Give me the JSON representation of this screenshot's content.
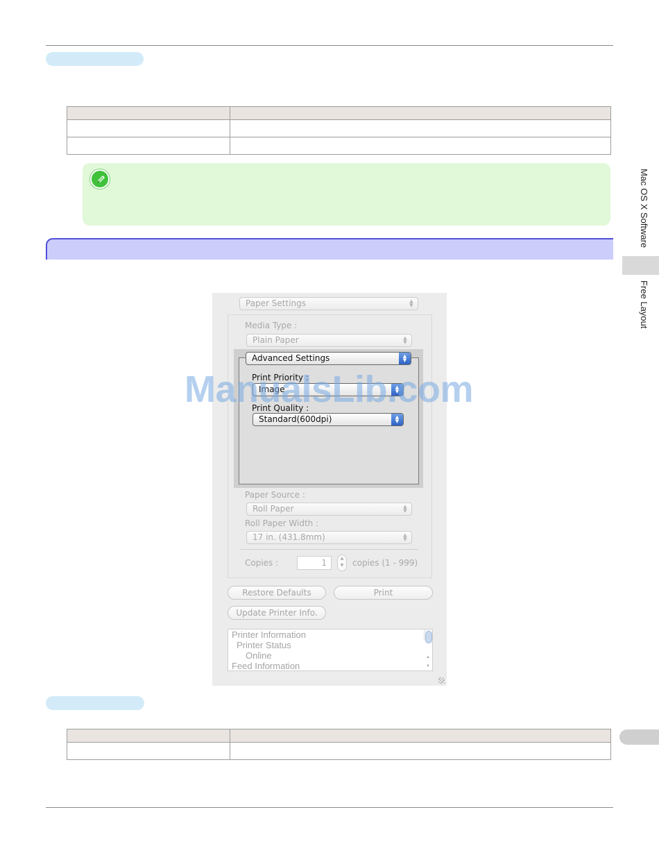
{
  "side_index": {
    "chapter": "Mac OS X Software",
    "section": "Free Layout"
  },
  "dialog": {
    "paper_settings_popup": "Paper Settings",
    "media_type_label": "Media Type :",
    "media_type_value": "Plain Paper",
    "advanced_settings_popup": "Advanced Settings",
    "print_priority_label": "Print Priority :",
    "print_priority_value": "Image",
    "print_quality_label": "Print Quality :",
    "print_quality_value": "Standard(600dpi)",
    "paper_source_label": "Paper Source :",
    "paper_source_value": "Roll Paper",
    "roll_paper_width_label": "Roll Paper Width :",
    "roll_paper_width_value": "17 in. (431.8mm)",
    "copies_label": "Copies :",
    "copies_value": "1",
    "copies_range": "copies (1 - 999)",
    "restore_defaults_button": "Restore Defaults",
    "print_button": "Print",
    "update_printer_info_button": "Update Printer Info.",
    "printer_info_list": [
      "Printer Information",
      "Printer Status",
      "Online",
      "Feed Information"
    ]
  },
  "watermark": "ManualsLib.com"
}
